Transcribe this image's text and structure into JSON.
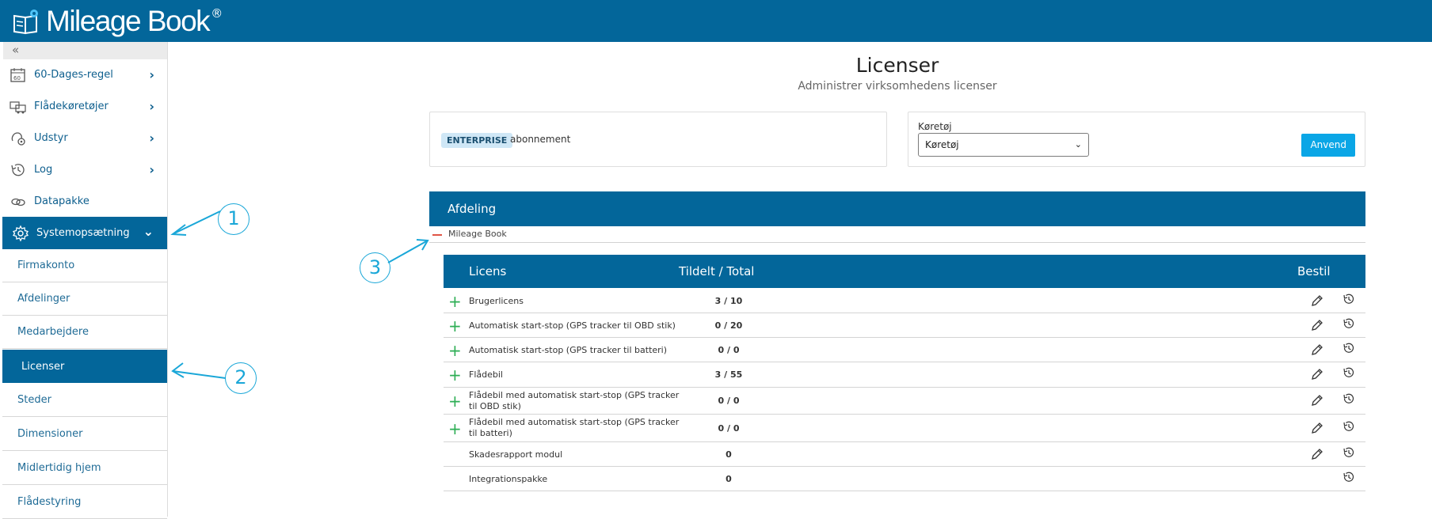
{
  "app": {
    "name": "Mileage Book",
    "reg": "®"
  },
  "sidebar": {
    "collapse": "«",
    "nav": [
      {
        "label": "60-Dages-regel",
        "icon": "calendar-60-icon"
      },
      {
        "label": "Flådekøretøjer",
        "icon": "vehicles-icon"
      },
      {
        "label": "Udstyr",
        "icon": "equipment-icon"
      },
      {
        "label": "Log",
        "icon": "history-icon"
      },
      {
        "label": "Datapakke",
        "icon": "link-icon"
      },
      {
        "label": "Systemopsætning",
        "icon": "gear-icon"
      }
    ],
    "sub": [
      {
        "label": "Firmakonto"
      },
      {
        "label": "Afdelinger"
      },
      {
        "label": "Medarbejdere"
      },
      {
        "label": "Licenser"
      },
      {
        "label": "Steder"
      },
      {
        "label": "Dimensioner"
      },
      {
        "label": "Midlertidig hjem"
      },
      {
        "label": "Flådestyring"
      }
    ]
  },
  "annotations": [
    "1",
    "2",
    "3"
  ],
  "main": {
    "title": "Licenser",
    "subtitle": "Administrer virksomhedens licenser",
    "subscription": {
      "badge": "ENTERPRISE",
      "text": "abonnement"
    },
    "filter": {
      "label": "Køretøj",
      "selected": "Køretøj",
      "apply": "Anvend"
    },
    "department": {
      "header": "Afdeling",
      "name": "Mileage Book"
    },
    "table": {
      "headers": {
        "license": "Licens",
        "assigned": "Tildelt / Total",
        "order": "Bestil"
      },
      "rows": [
        {
          "name": "Brugerlicens",
          "value": "3 / 10"
        },
        {
          "name": "Automatisk start-stop (GPS tracker til OBD stik)",
          "value": "0 / 20"
        },
        {
          "name": "Automatisk start-stop (GPS tracker til batteri)",
          "value": "0 / 0"
        },
        {
          "name": "Flådebil",
          "value": "3 / 55"
        },
        {
          "name": "Flådebil med automatisk start-stop (GPS tracker til OBD stik)",
          "value": "0 / 0"
        },
        {
          "name": "Flådebil med automatisk start-stop (GPS tracker til batteri)",
          "value": "0 / 0"
        },
        {
          "name": "Skadesrapport modul",
          "value": "0"
        },
        {
          "name": "Integrationspakke",
          "value": "0"
        }
      ]
    }
  },
  "colors": {
    "brand": "#03669a",
    "accent": "#0aa6e6",
    "plus": "#2eae55",
    "annotation": "#1aa7d8"
  }
}
